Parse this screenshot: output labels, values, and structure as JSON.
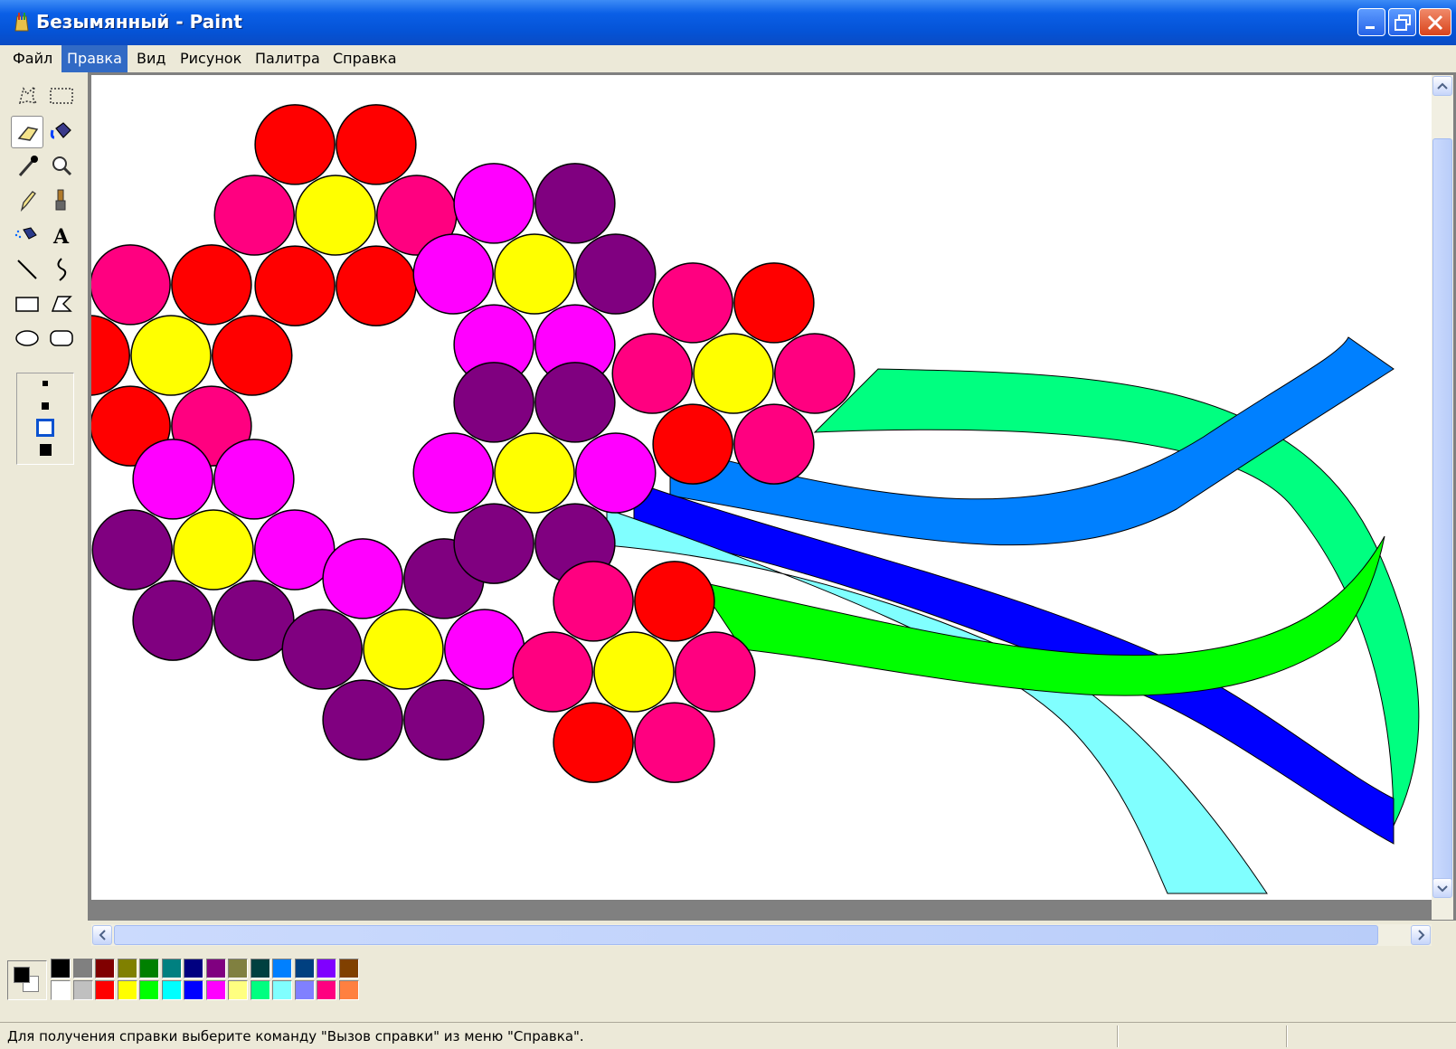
{
  "window": {
    "title": "Безымянный - Paint",
    "accent_color": "#0553d6"
  },
  "menu": {
    "items": [
      {
        "label": "Файл",
        "active": false
      },
      {
        "label": "Правка",
        "active": true
      },
      {
        "label": "Вид",
        "active": false
      },
      {
        "label": "Рисунок",
        "active": false
      },
      {
        "label": "Палитра",
        "active": false
      },
      {
        "label": "Справка",
        "active": false
      }
    ]
  },
  "toolbox": {
    "tools": [
      {
        "icon": "free-select-icon",
        "selected": false
      },
      {
        "icon": "rect-select-icon",
        "selected": false
      },
      {
        "icon": "eraser-icon",
        "selected": true
      },
      {
        "icon": "fill-bucket-icon",
        "selected": false
      },
      {
        "icon": "eyedropper-icon",
        "selected": false
      },
      {
        "icon": "magnifier-icon",
        "selected": false
      },
      {
        "icon": "pencil-icon",
        "selected": false
      },
      {
        "icon": "brush-icon",
        "selected": false
      },
      {
        "icon": "airbrush-icon",
        "selected": false
      },
      {
        "icon": "text-icon",
        "selected": false
      },
      {
        "icon": "line-icon",
        "selected": false
      },
      {
        "icon": "curve-icon",
        "selected": false
      },
      {
        "icon": "rectangle-icon",
        "selected": false
      },
      {
        "icon": "polygon-icon",
        "selected": false
      },
      {
        "icon": "ellipse-icon",
        "selected": false
      },
      {
        "icon": "rounded-rect-icon",
        "selected": false
      }
    ],
    "text_tool_glyph": "A",
    "eraser_sizes": [
      "small",
      "medium",
      "large",
      "xlarge"
    ],
    "eraser_selected": "large"
  },
  "palette": {
    "foreground": "#000000",
    "background": "#ffffff",
    "colors_top": [
      "#000000",
      "#808080",
      "#800000",
      "#808000",
      "#008000",
      "#008080",
      "#000080",
      "#800080",
      "#808040",
      "#004040",
      "#0080ff",
      "#004080",
      "#8000ff",
      "#804000"
    ],
    "colors_bottom": [
      "#ffffff",
      "#c0c0c0",
      "#ff0000",
      "#ffff00",
      "#00ff00",
      "#00ffff",
      "#0000ff",
      "#ff00ff",
      "#ffff80",
      "#00ff80",
      "#80ffff",
      "#8080ff",
      "#ff0080",
      "#ff8040"
    ]
  },
  "drawing": {
    "flower_colors": {
      "red": "#ff0000",
      "pink": "#ff0080",
      "yellow": "#ffff00",
      "purple": "#800080",
      "magenta": "#ff00ff"
    },
    "ribbon_colors": [
      "#00ff80",
      "#0080ff",
      "#0000ff",
      "#80ffff",
      "#00ff00"
    ]
  },
  "status": {
    "text": "Для получения справки выберите команду \"Вызов справки\" из меню \"Справка\"."
  }
}
